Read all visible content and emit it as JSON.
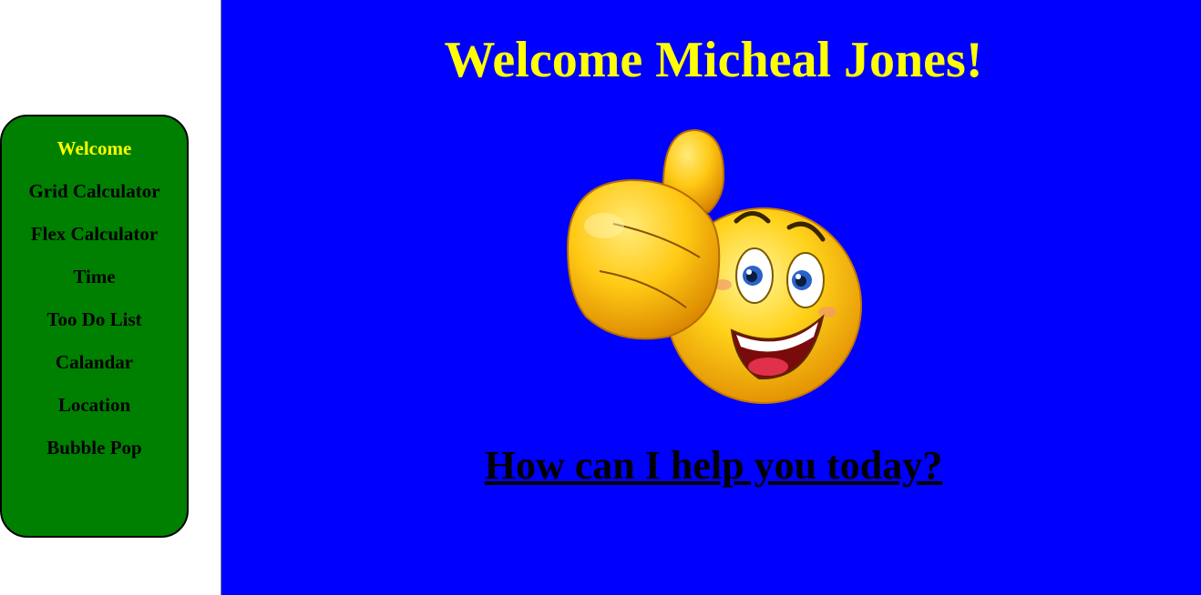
{
  "nav": {
    "items": [
      {
        "label": "Welcome",
        "active": true
      },
      {
        "label": "Grid Calculator",
        "active": false
      },
      {
        "label": "Flex Calculator",
        "active": false
      },
      {
        "label": "Time",
        "active": false
      },
      {
        "label": "Too Do List",
        "active": false
      },
      {
        "label": "Calandar",
        "active": false
      },
      {
        "label": "Location",
        "active": false
      },
      {
        "label": "Bubble Pop",
        "active": false
      }
    ]
  },
  "main": {
    "title": "Welcome Micheal Jones!",
    "image_icon": "thumbs-up-smiley-icon",
    "help_link": "How can I help you today?"
  },
  "colors": {
    "main_background": "#0000ff",
    "nav_background": "#008000",
    "title_color": "#ffff00",
    "active_nav_color": "#ffff00",
    "nav_text_color": "#000000"
  }
}
